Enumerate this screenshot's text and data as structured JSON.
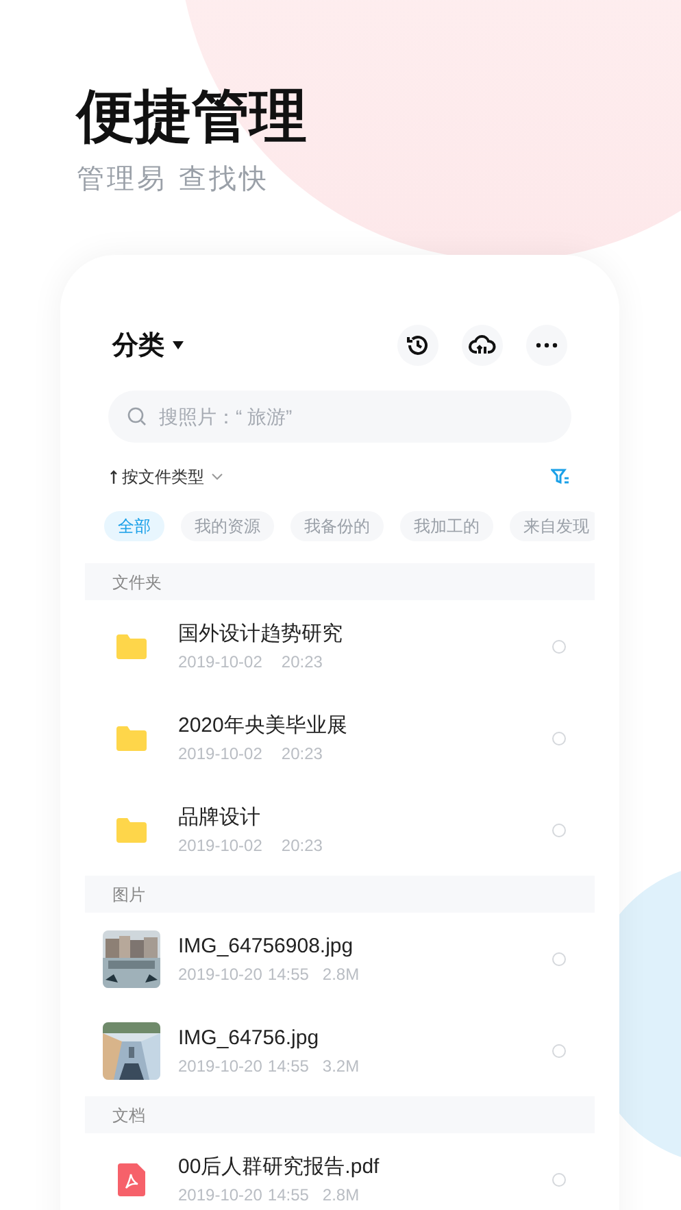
{
  "headline": "便捷管理",
  "subheadline": "管理易 查找快",
  "header": {
    "title": "分类"
  },
  "search": {
    "placeholder": "搜照片：“ 旅游”"
  },
  "sort": {
    "label": "按文件类型"
  },
  "chips": [
    {
      "label": "全部",
      "selected": true
    },
    {
      "label": "我的资源",
      "selected": false
    },
    {
      "label": "我备份的",
      "selected": false
    },
    {
      "label": "我加工的",
      "selected": false
    },
    {
      "label": "来自发现",
      "selected": false
    }
  ],
  "sections": [
    {
      "title": "文件夹",
      "items": [
        {
          "kind": "folder",
          "name": "国外设计趋势研究",
          "date": "2019-10-02",
          "time": "20:23",
          "selected": false
        },
        {
          "kind": "folder",
          "name": "2020年央美毕业展",
          "date": "2019-10-02",
          "time": "20:23",
          "selected": false
        },
        {
          "kind": "folder",
          "name": "品牌设计",
          "date": "2019-10-02",
          "time": "20:23",
          "selected": false
        }
      ]
    },
    {
      "title": "图片",
      "items": [
        {
          "name": "IMG_64756908.jpg",
          "date": "2019-10-20",
          "time": "14:55",
          "size": "2.8M",
          "selected": false
        },
        {
          "name": "IMG_64756.jpg",
          "date": "2019-10-20",
          "time": "14:55",
          "size": "3.2M",
          "selected": false
        }
      ]
    },
    {
      "title": "文档",
      "items": [
        {
          "kind": "pdf",
          "name": "00后人群研究报告.pdf",
          "date": "2019-10-20",
          "time": "14:55",
          "size": "2.8M",
          "selected": false
        }
      ]
    }
  ]
}
